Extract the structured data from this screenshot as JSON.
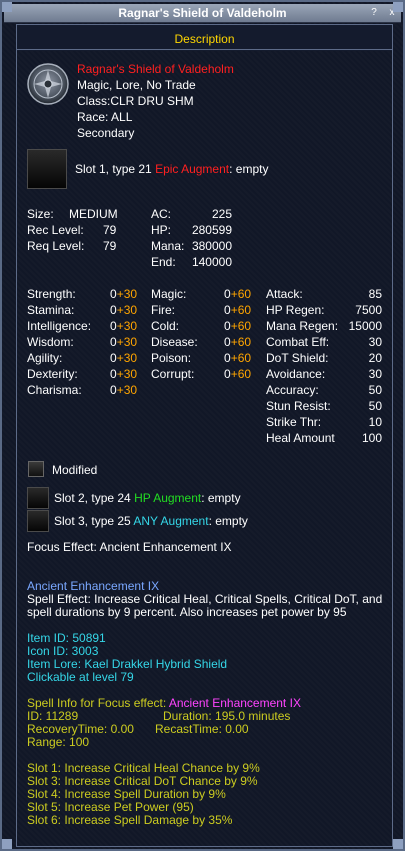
{
  "window": {
    "title": "Ragnar's Shield of Valdeholm",
    "help_btn": "?",
    "close_btn": "x"
  },
  "section_title": "Description",
  "item": {
    "name": "Ragnar's Shield of Valdeholm",
    "flags": "Magic, Lore, No Trade",
    "class": "Class:CLR DRU SHM",
    "race": "Race:  ALL",
    "slot_type": "Secondary"
  },
  "augments": {
    "slot1": {
      "label": "Slot 1, type 21 ",
      "type": "Epic Augment",
      "status": ": empty"
    },
    "slot2": {
      "label": "Slot 2, type 24 ",
      "type": "HP Augment",
      "status": ": empty"
    },
    "slot3": {
      "label": "Slot 3, type 25 ",
      "type": "ANY Augment",
      "status": ": empty"
    }
  },
  "basic": {
    "size_label": "Size:",
    "size": "MEDIUM",
    "rec_label": "Rec Level:",
    "rec": "79",
    "req_label": "Req Level:",
    "req": "79",
    "ac_label": "AC:",
    "ac": "225",
    "hp_label": "HP:",
    "hp": "280599",
    "mana_label": "Mana:",
    "mana": "380000",
    "end_label": "End:",
    "end": "140000"
  },
  "stats": [
    {
      "label": "Strength:",
      "base": "0",
      "bonus": "+30"
    },
    {
      "label": "Stamina:",
      "base": "0",
      "bonus": "+30"
    },
    {
      "label": "Intelligence:",
      "base": "0",
      "bonus": "+30"
    },
    {
      "label": "Wisdom:",
      "base": "0",
      "bonus": "+30"
    },
    {
      "label": "Agility:",
      "base": "0",
      "bonus": "+30"
    },
    {
      "label": "Dexterity:",
      "base": "0",
      "bonus": "+30"
    },
    {
      "label": "Charisma:",
      "base": "0",
      "bonus": "+30"
    }
  ],
  "resists": [
    {
      "label": "Magic:",
      "base": "0",
      "bonus": "+60"
    },
    {
      "label": "Fire:",
      "base": "0",
      "bonus": "+60"
    },
    {
      "label": "Cold:",
      "base": "0",
      "bonus": "+60"
    },
    {
      "label": "Disease:",
      "base": "0",
      "bonus": "+60"
    },
    {
      "label": "Poison:",
      "base": "0",
      "bonus": "+60"
    },
    {
      "label": "Corrupt:",
      "base": "0",
      "bonus": "+60"
    }
  ],
  "mods": [
    {
      "label": "Attack:",
      "value": "85"
    },
    {
      "label": "HP Regen:",
      "value": "7500"
    },
    {
      "label": "Mana Regen:",
      "value": "15000"
    },
    {
      "label": "Combat Eff:",
      "value": "30"
    },
    {
      "label": "DoT Shield:",
      "value": "20"
    },
    {
      "label": "Avoidance:",
      "value": "30"
    },
    {
      "label": "Accuracy:",
      "value": "50"
    },
    {
      "label": "Stun Resist:",
      "value": "50"
    },
    {
      "label": "Strike Thr:",
      "value": "10"
    },
    {
      "label": "Heal Amount",
      "value": "100"
    }
  ],
  "modified_label": "Modified",
  "focus_effect": "Focus Effect: Ancient Enhancement IX",
  "spell": {
    "name": "Ancient Enhancement IX",
    "effect_line1": "Spell Effect: Increase Critical Heal, Critical Spells, Critical DoT, and",
    "effect_line2": "spell durations by 9 percent. Also increases pet power by 95"
  },
  "ids": {
    "item_id": "Item ID: 50891",
    "icon_id": "Icon ID: 3003",
    "lore": "Item Lore: Kael Drakkel Hybrid Shield",
    "clickable": "Clickable at level 79"
  },
  "spell_info": {
    "prefix": "Spell Info for Focus effect: ",
    "name": "Ancient Enhancement IX",
    "id": "ID: 11289",
    "duration": "Duration: 195.0 minutes",
    "recovery": "RecoveryTime: 0.00",
    "recast": "RecastTime: 0.00",
    "range": "Range: 100"
  },
  "slots": [
    "Slot 1: Increase Critical Heal Chance by 9%",
    "Slot 3: Increase Critical DoT Chance by 9%",
    "Slot 4: Increase Spell Duration by 9%",
    "Slot 5: Increase Pet Power (95)",
    "Slot 6: Increase Spell Damage by 35%"
  ],
  "colors": {
    "title_text": "#ffffff",
    "section_header": "#ffd700",
    "item_name": "#ff2020",
    "bonus": "#ffa500",
    "hp_aug": "#22dd22",
    "any_aug": "#35d7e8",
    "spell_name": "#7aa8ff",
    "ids": "#35d7e8",
    "spell_info": "#cccc20",
    "spell_info_name": "#ff44ff"
  }
}
